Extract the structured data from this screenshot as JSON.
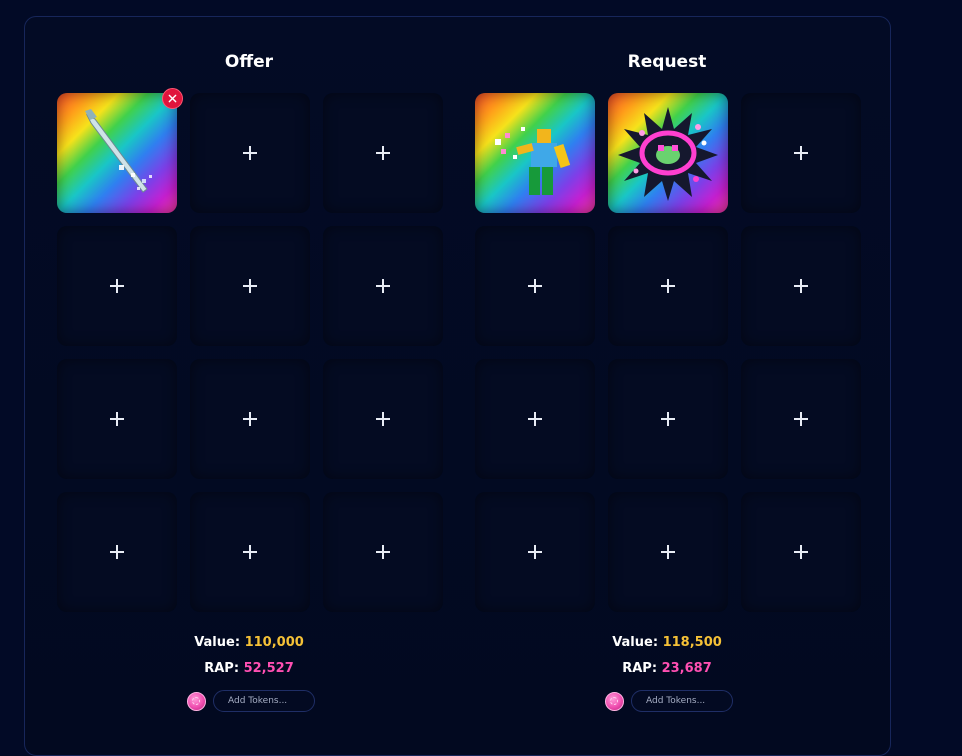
{
  "offer": {
    "title": "Offer",
    "value_label": "Value:",
    "value": "110,000",
    "rap_label": "RAP:",
    "rap": "52,527",
    "tokens_placeholder": "Add Tokens..."
  },
  "request": {
    "title": "Request",
    "value_label": "Value:",
    "value": "118,500",
    "rap_label": "RAP:",
    "rap": "23,687",
    "tokens_placeholder": "Add Tokens..."
  },
  "colors": {
    "background": "#020a26",
    "value": "#f5c137",
    "rap": "#ff4fb2",
    "remove": "#e0143c"
  },
  "icons": {
    "add_slot": "plus-icon",
    "remove_item": "close-icon",
    "token": "token-coin-icon"
  }
}
